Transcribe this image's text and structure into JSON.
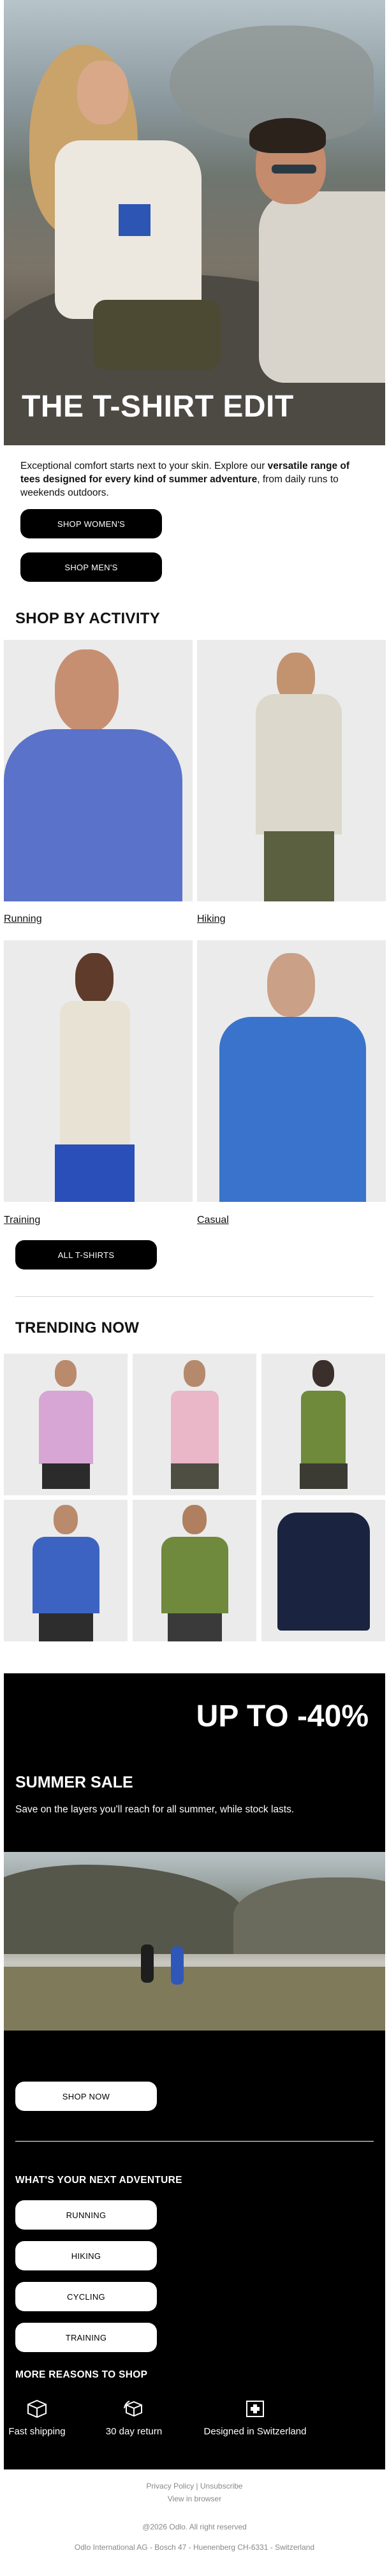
{
  "hero": {
    "title": "THE T-SHIRT EDIT"
  },
  "intro": {
    "part1": "Exceptional comfort starts next to your skin. Explore our ",
    "bold": "versatile range of tees designed for every kind of summer adventure",
    "part2": ", from daily runs to weekends outdoors."
  },
  "buttons": {
    "shop_women": "SHOP WOMEN'S",
    "shop_men": "SHOP MEN'S",
    "all_tshirts": "ALL T-SHIRTS",
    "shop_now": "SHOP NOW"
  },
  "activity": {
    "heading": "SHOP BY ACTIVITY",
    "items": [
      {
        "label": "Running"
      },
      {
        "label": "Hiking"
      },
      {
        "label": "Training"
      },
      {
        "label": "Casual"
      }
    ]
  },
  "trending": {
    "heading": "TRENDING NOW"
  },
  "sale": {
    "percent": "UP TO -40%",
    "title": "SUMMER SALE",
    "desc": "Save on the layers you'll reach for all summer, while stock lasts."
  },
  "adventure": {
    "heading": "WHAT'S YOUR NEXT ADVENTURE",
    "items": [
      "RUNNING",
      "HIKING",
      "CYCLING",
      "TRAINING"
    ]
  },
  "reasons": {
    "heading": "MORE REASONS TO SHOP",
    "items": [
      {
        "label": "Fast shipping",
        "icon": "box-icon"
      },
      {
        "label": "30 day return",
        "icon": "return-box-icon"
      },
      {
        "label": "Designed in Switzerland",
        "icon": "swiss-cross-icon"
      }
    ]
  },
  "footer": {
    "privacy": "Privacy Policy",
    "sep": "|",
    "unsubscribe": "Unsubscribe",
    "view_browser": "View in browser",
    "copyright": "@2026 Odlo. All right reserved",
    "address": "Odlo International AG - Bosch 47 - Huenenberg CH-6331 - Switzerland"
  },
  "colors": {
    "accent_blue": "#2d55b3",
    "black": "#000000",
    "tile_bg": "#ebebeb"
  }
}
